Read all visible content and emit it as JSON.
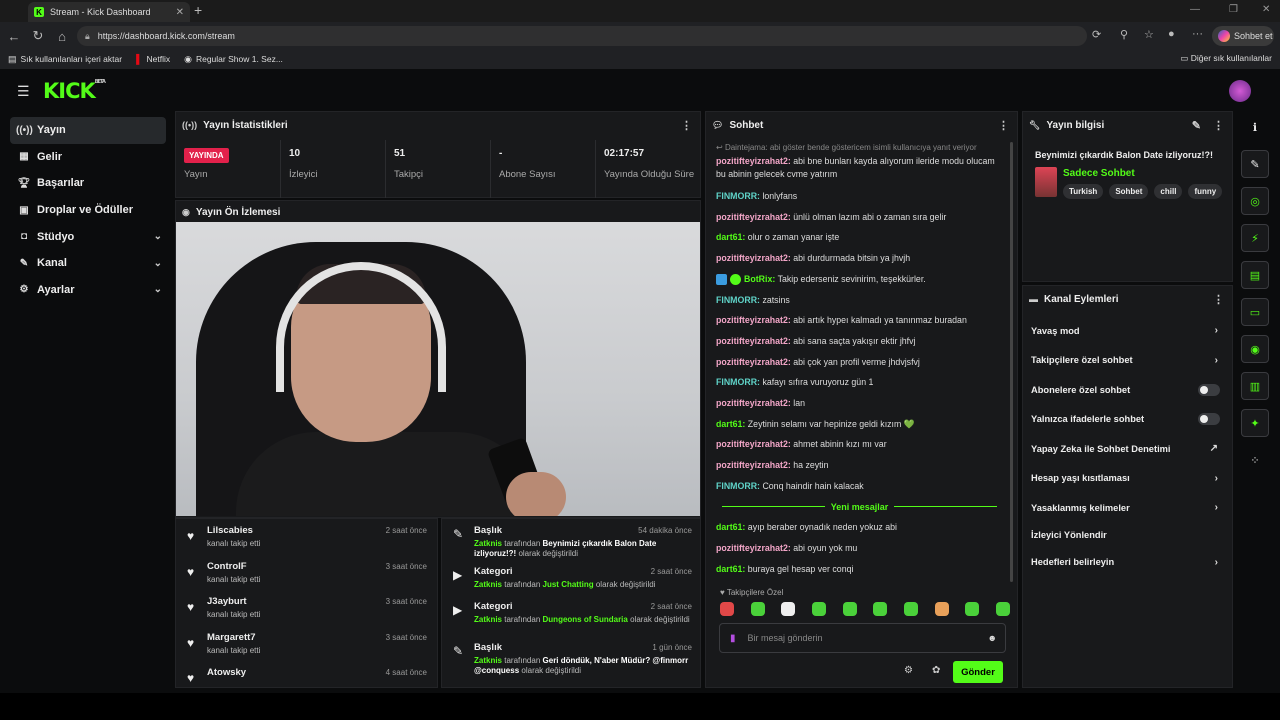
{
  "browser": {
    "tab_title": "Stream - Kick Dashboard",
    "tab_favicon": "K",
    "url": "https://dashboard.kick.com/stream",
    "copilot_label": "Sohbet et",
    "bookmarks": [
      "Sık kullanılanları içeri aktar",
      "Netflix",
      "Regular Show 1. Sez..."
    ],
    "other_bookmarks": "Diğer sık kullanılanlar"
  },
  "app": {
    "logo": "KICK",
    "logo_beta": "BETA"
  },
  "sidebar": {
    "items": [
      {
        "label": "Yayın",
        "icon": "broadcast-icon"
      },
      {
        "label": "Gelir",
        "icon": "income-icon"
      },
      {
        "label": "Başarılar",
        "icon": "trophy-icon"
      },
      {
        "label": "Droplar ve Ödüller",
        "icon": "gift-icon"
      },
      {
        "label": "Stüdyo",
        "icon": "studio-icon"
      },
      {
        "label": "Kanal",
        "icon": "channel-icon"
      },
      {
        "label": "Ayarlar",
        "icon": "gear-icon"
      }
    ]
  },
  "stats": {
    "title": "Yayın İstatistikleri",
    "live_badge": "YAYINDA",
    "items": [
      {
        "value": "",
        "label": "Yayın"
      },
      {
        "value": "10",
        "label": "İzleyici"
      },
      {
        "value": "51",
        "label": "Takipçi"
      },
      {
        "value": "-",
        "label": "Abone Sayısı"
      },
      {
        "value": "02:17:57",
        "label": "Yayında Olduğu Süre"
      }
    ]
  },
  "preview": {
    "title": "Yayın Ön İzlemesi"
  },
  "followers": [
    {
      "name": "Lilscabies",
      "sub": "kanalı takip etti",
      "time": "2 saat önce"
    },
    {
      "name": "ControlF",
      "sub": "kanalı takip etti",
      "time": "3 saat önce"
    },
    {
      "name": "J3ayburt",
      "sub": "kanalı takip etti",
      "time": "3 saat önce"
    },
    {
      "name": "Margarett7",
      "sub": "kanalı takip etti",
      "time": "3 saat önce"
    },
    {
      "name": "Atowsky",
      "sub": "",
      "time": "4 saat önce"
    }
  ],
  "activity": [
    {
      "title": "Başlık",
      "time": "54 dakika önce",
      "user": "Zatknis",
      "mid": "tarafından",
      "value": "Beynimizi çıkardık Balon Date izliyoruz!?!",
      "end": "olarak değiştirildi"
    },
    {
      "title": "Kategori",
      "time": "2 saat önce",
      "user": "Zatknis",
      "mid": "tarafından",
      "value": "Just Chatting",
      "end": "olarak değiştirildi"
    },
    {
      "title": "Kategori",
      "time": "2 saat önce",
      "user": "Zatknis",
      "mid": "tarafından",
      "value": "Dungeons of Sundaria",
      "end": "olarak değiştirildi"
    },
    {
      "title": "Başlık",
      "time": "1 gün önce",
      "user": "Zatknis",
      "mid": "tarafından",
      "value": "Geri döndük, N'aber Müdür? @finmorr @conquess",
      "end": "olarak değiştirildi"
    }
  ],
  "chat": {
    "title": "Sohbet",
    "reply_note": "Daintejama: abi göster bende göstericem isimli kullanıcıya yanıt veriyor",
    "messages": [
      {
        "user": "pozitifteyizrahat2:",
        "text": "abi bne bunları kayda alıyorum ileride modu olucam bu abinin gelecek cvme yatırım"
      },
      {
        "user": "FINMORR:",
        "text": "lonlyfans"
      },
      {
        "user": "pozitifteyizrahat2:",
        "text": "ünlü olman lazım abi o zaman sıra gelir"
      },
      {
        "user": "dart61:",
        "text": "olur o zaman yanar işte"
      },
      {
        "user": "pozitifteyizrahat2:",
        "text": "abi durdurmada bitsin ya jhvjh"
      },
      {
        "user": "BotRix:",
        "text": "Takip ederseniz sevinirim, teşekkürler."
      },
      {
        "user": "FINMORR:",
        "text": "zatsins"
      },
      {
        "user": "pozitifteyizrahat2:",
        "text": "abi artık hypeı kalmadı ya tanınmaz buradan"
      },
      {
        "user": "pozitifteyizrahat2:",
        "text": "abi sana saçta yakışır ektir jhfvj"
      },
      {
        "user": "pozitifteyizrahat2:",
        "text": "abi çok yan profil verme jhdvjsfvj"
      },
      {
        "user": "FINMORR:",
        "text": "kafayı sıfıra vuruyoruz gün 1"
      },
      {
        "user": "pozitifteyizrahat2:",
        "text": "lan"
      },
      {
        "user": "dart61:",
        "text": "Zeytinin selamı var hepinize geldi kızım 💚"
      },
      {
        "user": "pozitifteyizrahat2:",
        "text": "ahmet abinin kızı mı var"
      },
      {
        "user": "pozitifteyizrahat2:",
        "text": "ha zeytin"
      },
      {
        "user": "FINMORR:",
        "text": "Conq haindir hain kalacak"
      }
    ],
    "new_messages_label": "Yeni mesajlar",
    "new_messages": [
      {
        "user": "dart61:",
        "text": "ayıp beraber oynadık neden yokuz abi"
      },
      {
        "user": "pozitifteyizrahat2:",
        "text": "abi oyun yok mu"
      },
      {
        "user": "dart61:",
        "text": "buraya gel hesap ver conqi"
      }
    ],
    "followers_only": "Takipçilere Özel",
    "input_placeholder": "Bir mesaj gönderin",
    "send_label": "Gönder"
  },
  "stream_info": {
    "title": "Yayın bilgisi",
    "stream_title": "Beynimizi çıkardık Balon Date izliyoruz!?!",
    "category": "Sadece Sohbet",
    "tags": [
      "Turkish",
      "Sohbet",
      "chill",
      "funny"
    ]
  },
  "channel_actions": {
    "title": "Kanal Eylemleri",
    "items": [
      {
        "label": "Yavaş mod",
        "control": "chevron"
      },
      {
        "label": "Takipçilere özel sohbet",
        "control": "chevron"
      },
      {
        "label": "Abonelere özel sohbet",
        "control": "toggle"
      },
      {
        "label": "Yalnızca ifadelerle sohbet",
        "control": "toggle"
      },
      {
        "label": "Yapay Zeka ile Sohbet Denetimi",
        "control": "external"
      },
      {
        "label": "Hesap yaşı kısıtlaması",
        "control": "chevron"
      },
      {
        "label": "Yasaklanmış kelimeler",
        "control": "chevron"
      },
      {
        "label": "İzleyici Yönlendir",
        "control": "none"
      },
      {
        "label": "Hedefleri belirleyin",
        "control": "chevron"
      }
    ]
  },
  "colors": {
    "accent": "#53fc18",
    "live": "#e2214b",
    "panel": "#18191b"
  }
}
